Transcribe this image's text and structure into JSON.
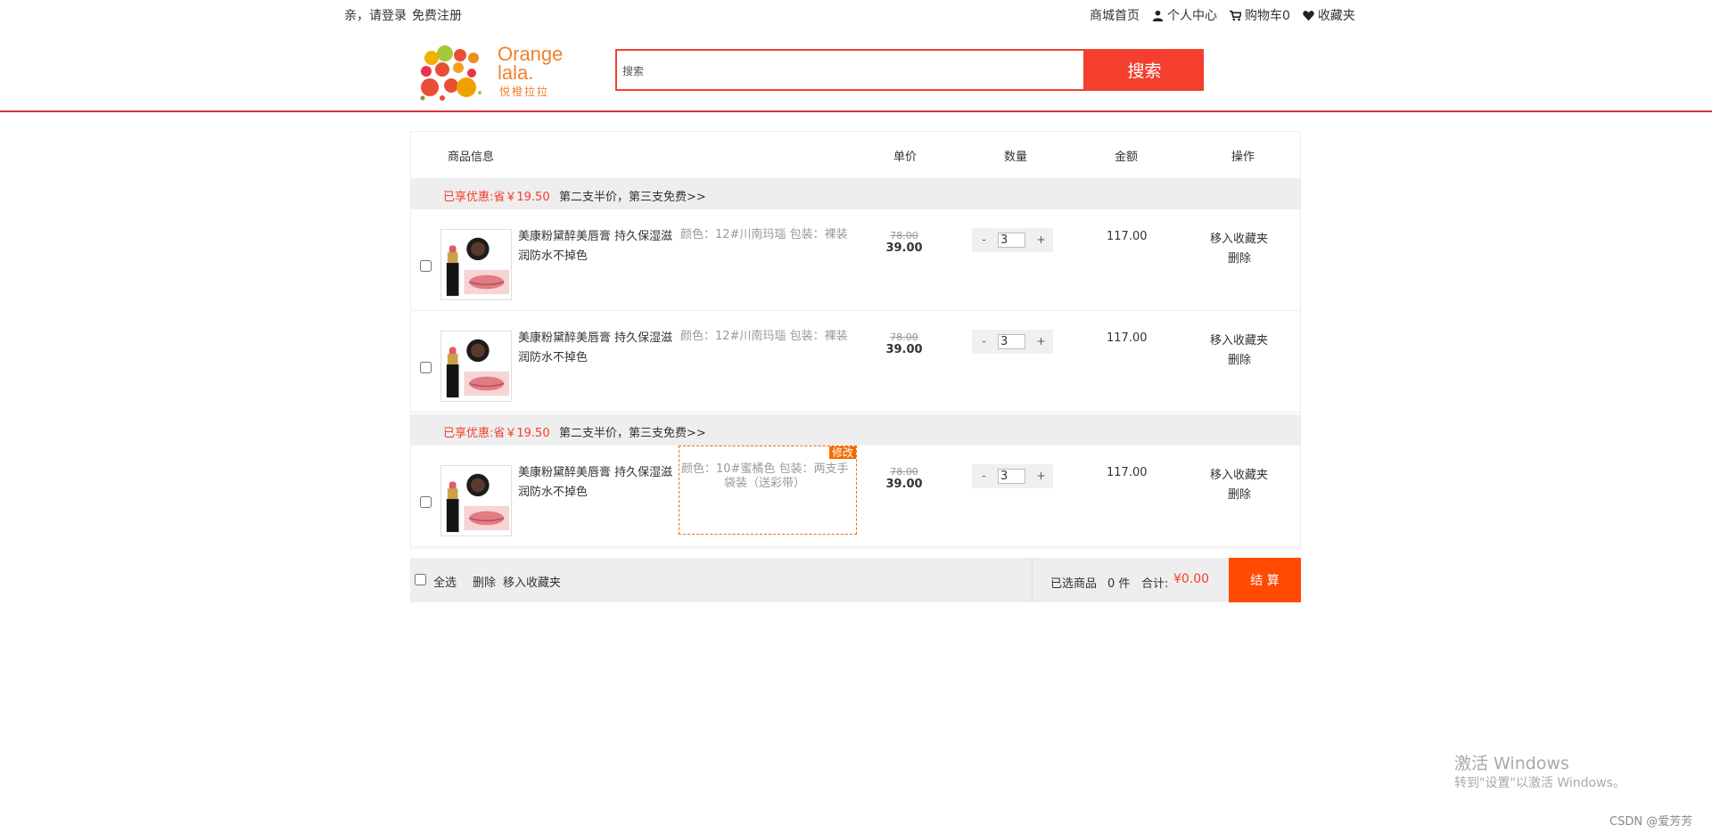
{
  "topbar": {
    "greeting": "亲，请登录",
    "register": "免费注册",
    "home": "商城首页",
    "user_center": "个人中心",
    "cart": "购物车0",
    "favorites": "收藏夹"
  },
  "header": {
    "logo_line1": "Orange",
    "logo_line2": "lala.",
    "logo_sub": "悦橙拉拉",
    "search_placeholder": "搜索",
    "search_button": "搜索"
  },
  "columns": {
    "info": "商品信息",
    "price": "单价",
    "quantity": "数量",
    "amount": "金额",
    "action": "操作"
  },
  "promos": [
    {
      "discount": "已享优惠:省￥19.50",
      "offer": "第二支半价，第三支免费>>"
    },
    {
      "discount": "已享优惠:省￥19.50",
      "offer": "第二支半价，第三支免费>>"
    }
  ],
  "items": [
    {
      "name": "美康粉黛醉美唇膏 持久保湿滋润防水不掉色",
      "spec": "颜色：12#川南玛瑙 包装：裸装",
      "old_price": "78.00",
      "price": "39.00",
      "qty_minus": "-",
      "qty": "3",
      "qty_plus": "+",
      "amount": "117.00",
      "move_fav": "移入收藏夹",
      "delete": "删除"
    },
    {
      "name": "美康粉黛醉美唇膏 持久保湿滋润防水不掉色",
      "spec": "颜色：12#川南玛瑙 包装：裸装",
      "old_price": "78.00",
      "price": "39.00",
      "qty_minus": "-",
      "qty": "3",
      "qty_plus": "+",
      "amount": "117.00",
      "move_fav": "移入收藏夹",
      "delete": "删除"
    },
    {
      "name": "美康粉黛醉美唇膏 持久保湿滋润防水不掉色",
      "spec_line1": "颜色：10#蜜橘色 包装：两支手",
      "spec_line2": "袋装（送彩带）",
      "edit_tag": "修改",
      "old_price": "78.00",
      "price": "39.00",
      "qty_minus": "-",
      "qty": "3",
      "qty_plus": "+",
      "amount": "117.00",
      "move_fav": "移入收藏夹",
      "delete": "删除"
    }
  ],
  "footer": {
    "select_all": "全选",
    "delete": "删除",
    "move_fav": "移入收藏夹",
    "selected_label": "已选商品",
    "selected_count": "0 件",
    "total_label": "合计:",
    "total": "¥0.00",
    "checkout": "结 算"
  },
  "watermark": {
    "title": "激活 Windows",
    "sub": "转到\"设置\"以激活 Windows。"
  },
  "credit": "CSDN @爱芳芳",
  "colors": {
    "accent": "#f43e2e",
    "checkout": "#ff4a00",
    "header_line": "#d7333c",
    "edit": "#f56a00"
  }
}
